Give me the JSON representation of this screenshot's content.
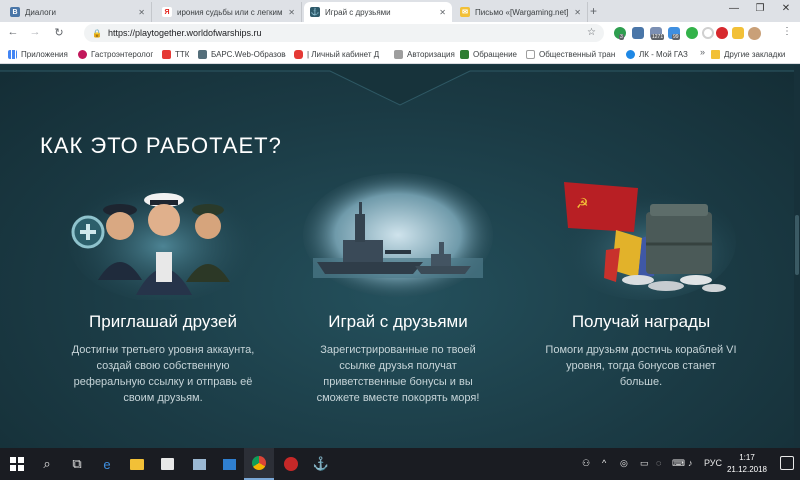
{
  "browser": {
    "tabs": [
      {
        "label": "Диалоги",
        "active": false
      },
      {
        "label": "ирония судьбы или с легким па",
        "active": false
      },
      {
        "label": "Играй с друзьями",
        "active": true
      },
      {
        "label": "Письмо «[Wargaming.net] На Ва",
        "active": false
      }
    ],
    "url": "https://playtogether.worldofwarships.ru",
    "extension_badges": [
      "3",
      "1271",
      "99"
    ]
  },
  "bookmarks": {
    "items": [
      "Приложения",
      "Гастроэнтеролог",
      "ТТК",
      "БАРС.Web-Образова",
      "| Личный кабинет Д",
      "Авторизация",
      "Обращение",
      "Общественный тран",
      "ЛК - Мой ГАЗ"
    ],
    "other": "Другие закладки"
  },
  "page": {
    "section_title": "КАК ЭТО РАБОТАЕТ?",
    "cards": [
      {
        "title": "Приглашай друзей",
        "description": "Достигни третьего уровня аккаунта, создай свою собственную реферальную ссылку и отправь её своим друзьям.",
        "icon": "officers-invite-icon"
      },
      {
        "title": "Играй с друзьями",
        "description": "Зарегистрированные по твоей ссылке друзья получат приветственные бонусы и вы сможете вместе покорять моря!",
        "icon": "battleships-icon"
      },
      {
        "title": "Получай награды",
        "description": "Помоги друзьям достичь кораблей VI уровня, тогда бонусов станет больше.",
        "icon": "rewards-chest-icon"
      }
    ]
  },
  "taskbar": {
    "language": "РУС",
    "time": "1:17",
    "date": "21.12.2018"
  },
  "colors": {
    "page_background": "#1b3b45",
    "title_text": "#ffffff",
    "description_text": "#c6d4d8",
    "taskbar": "#1a1c22"
  }
}
